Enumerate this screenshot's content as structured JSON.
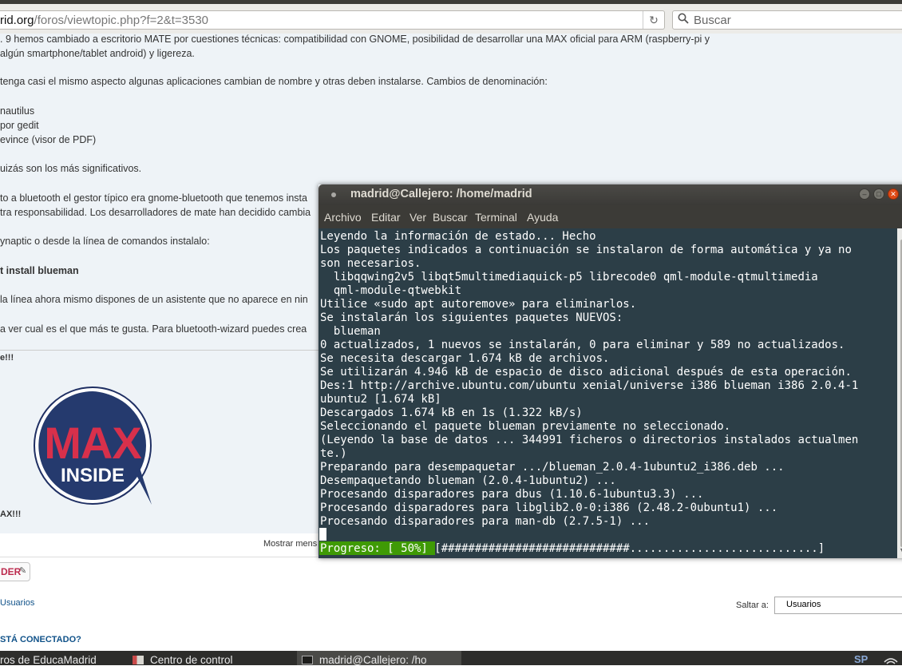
{
  "browser": {
    "url_host": "rid.org",
    "url_path": "/foros/viewtopic.php?f=2&t=3530",
    "reload_icon": "reload-icon",
    "search_placeholder": "Buscar"
  },
  "post": {
    "lines": [
      ". 9 hemos cambiado a escritorio MATE por cuestiones técnicas: compatibilidad con GNOME, posibilidad de desarrollar una MAX oficial para ARM (raspberry-pi y",
      "algún smartphone/tablet android) y ligereza.",
      "tenga casi el mismo aspecto algunas aplicaciones cambian de nombre y otras deben instalarse. Cambios de denominación:",
      " nautilus",
      "por gedit",
      " evince (visor de PDF)",
      "uizás son los más significativos.",
      "to a bluetooth el gestor típico era gnome-bluetooth que tenemos insta",
      "tra responsabilidad. Los desarrolladores de mate han decidido cambia",
      "ynaptic o desde la línea de comandos instalalo:",
      "t install blueman",
      "la línea ahora mismo dispones de un asistente que no aparece en nin",
      "a ver cual es el que más te gusta. Para bluetooth-wizard puedes crea",
      "e!!!",
      "AX!!!"
    ],
    "logo": {
      "top": "MAX",
      "bottom": "INSIDE"
    },
    "show_messages": "Mostrar mens",
    "reply_label": "DER",
    "users_link": "Usuarios",
    "jump_label": "Saltar a:",
    "jump_value": "Usuarios",
    "who_online": "STÁ CONECTADO?"
  },
  "terminal": {
    "title": "madrid@Callejero: /home/madrid",
    "menu": [
      "Archivo",
      "Editar",
      "Ver",
      "Buscar",
      "Terminal",
      "Ayuda"
    ],
    "lines": [
      "Leyendo la información de estado... Hecho",
      "Los paquetes indicados a continuación se instalaron de forma automática y ya no",
      "son necesarios.",
      "  libqqwing2v5 libqt5multimediaquick-p5 librecode0 qml-module-qtmultimedia",
      "  qml-module-qtwebkit",
      "Utilice «sudo apt autoremove» para eliminarlos.",
      "Se instalarán los siguientes paquetes NUEVOS:",
      "  blueman",
      "0 actualizados, 1 nuevos se instalarán, 0 para eliminar y 589 no actualizados.",
      "Se necesita descargar 1.674 kB de archivos.",
      "Se utilizarán 4.946 kB de espacio de disco adicional después de esta operación.",
      "Des:1 http://archive.ubuntu.com/ubuntu xenial/universe i386 blueman i386 2.0.4-1",
      "ubuntu2 [1.674 kB]",
      "Descargados 1.674 kB en 1s (1.322 kB/s)",
      "Seleccionando el paquete blueman previamente no seleccionado.",
      "(Leyendo la base de datos ... 344991 ficheros o directorios instalados actualmen",
      "te.)",
      "Preparando para desempaquetar .../blueman_2.0.4-1ubuntu2_i386.deb ...",
      "Desempaquetando blueman (2.0.4-1ubuntu2) ...",
      "Procesando disparadores para dbus (1.10.6-1ubuntu3.3) ...",
      "Procesando disparadores para libglib2.0-0:i386 (2.48.2-0ubuntu1) ...",
      "Procesando disparadores para man-db (2.7.5-1) ...",
      "",
      "Progreso: [ 50%] [############################............................]"
    ],
    "progress_percent": 50,
    "colors": {
      "background": "#2c3e47",
      "progress": "#3f9a05",
      "close": "#df4a16"
    }
  },
  "taskbar": {
    "items": [
      "ros de EducaMadrid",
      "Centro de control",
      "madrid@Callejero: /ho"
    ],
    "indicator": "SP"
  }
}
